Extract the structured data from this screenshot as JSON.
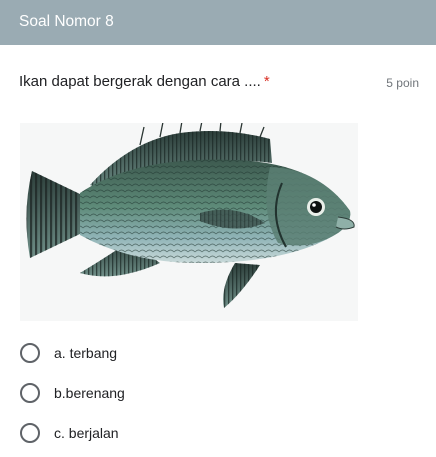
{
  "section": {
    "title": "Soal Nomor 8"
  },
  "question": {
    "text": "Ikan dapat bergerak dengan cara ....",
    "required_mark": "*",
    "points": "5 poin",
    "image": {
      "subject": "tilapia-fish",
      "alt_icon": "fish-image"
    },
    "options": [
      {
        "label": "a. terbang",
        "selected": false
      },
      {
        "label": "b.berenang",
        "selected": false
      },
      {
        "label": "c. berjalan",
        "selected": false
      }
    ]
  },
  "colors": {
    "header_bg": "#9aabb3",
    "required": "#d93025",
    "radio_border": "#5f6368",
    "text": "#202124",
    "muted": "#70757a"
  }
}
